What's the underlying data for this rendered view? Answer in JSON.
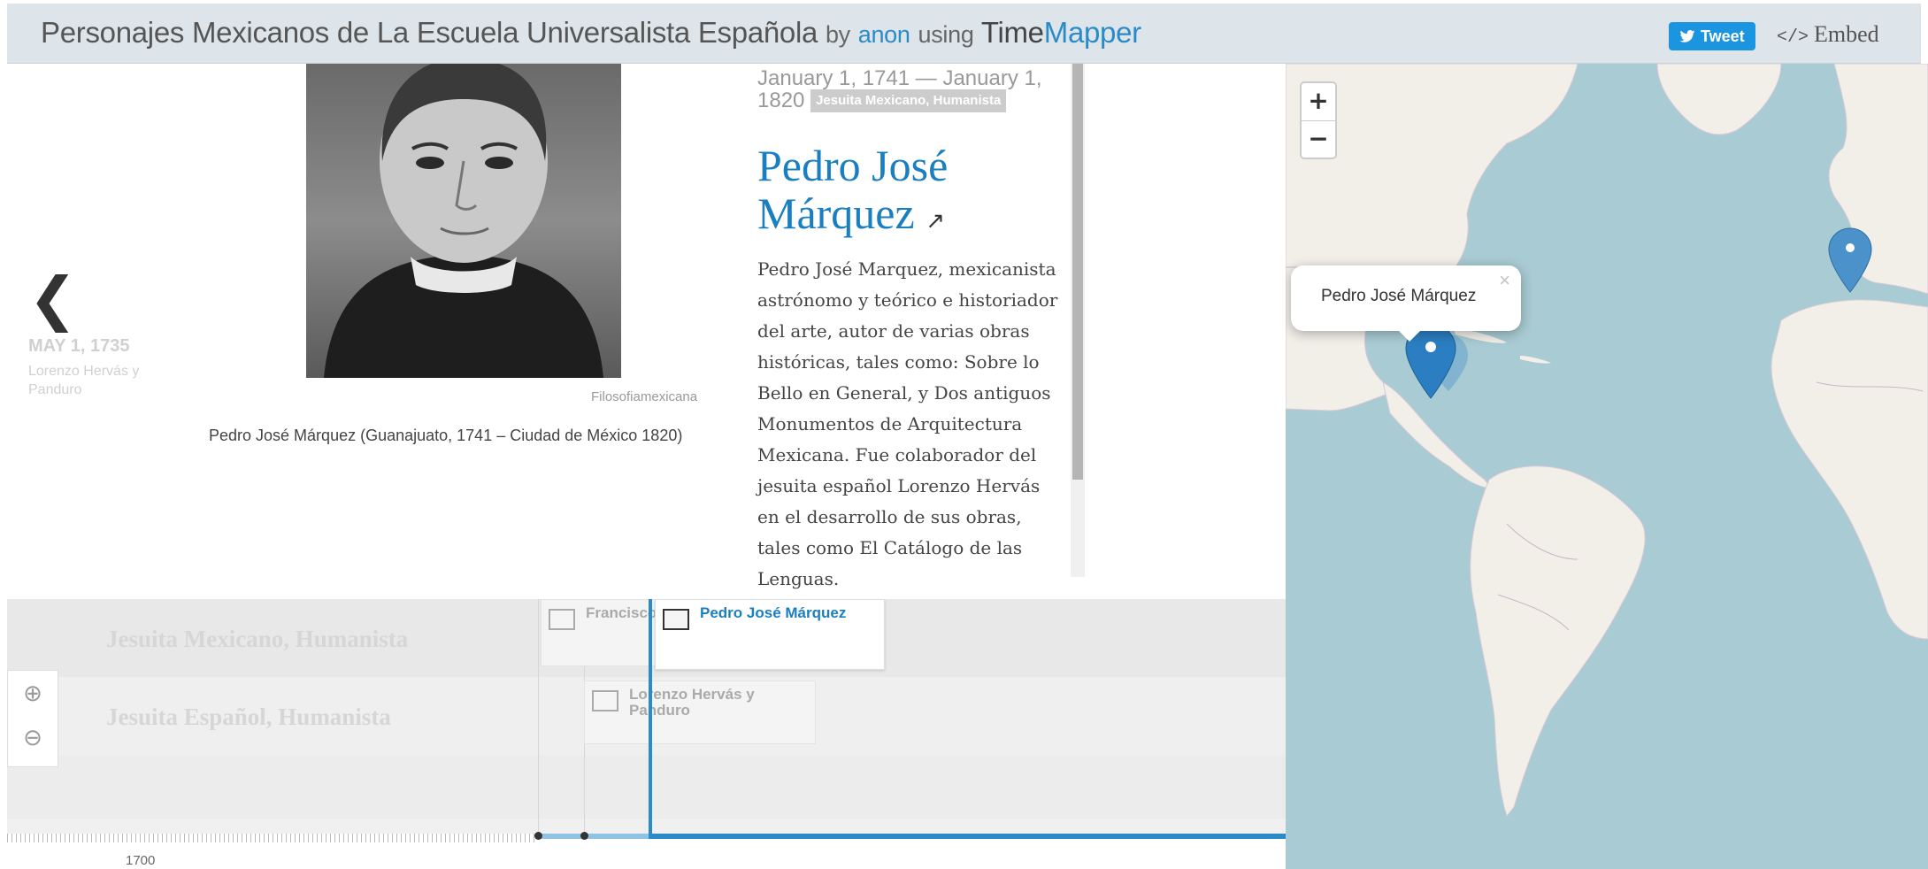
{
  "header": {
    "title": "Personajes Mexicanos de La Escuela Universalista Española",
    "by_label": "by",
    "author": "anon",
    "using_label": "using",
    "app_part1": "Time",
    "app_part2": "Mapper",
    "tweet_label": "Tweet",
    "embed_code": "</>",
    "embed_label": "Embed"
  },
  "prev_slide": {
    "date": "MAY 1, 1735",
    "name": "Lorenzo Hervás y Panduro"
  },
  "slide": {
    "credit": "Filosofiamexicana",
    "caption": "Pedro José Márquez (Guanajuato, 1741 – Ciudad de México 1820)",
    "dates": "January 1, 1741 — January 1, 1820",
    "tag": "Jesuita Mexicano, Humanista",
    "headline": "Pedro José Márquez",
    "body": "Pedro José Marquez, mexicanista astrónomo y teórico e historiador del arte, autor de varias obras históricas, tales como: Sobre lo Bello en General, y Dos antiguos Monumentos de Arquitectura Mexicana. Fue colaborador del jesuita español Lorenzo Hervás en el desarrollo de sus obras, tales como El Catálogo de las Lenguas."
  },
  "timeline": {
    "groups": [
      "Jesuita Mexicano, Humanista",
      "Jesuita Español, Humanista"
    ],
    "markers": [
      {
        "label": "Francisco Clavijero",
        "state": "dim"
      },
      {
        "label": "Pedro José Márquez",
        "state": "active"
      },
      {
        "label": "Lorenzo Hervás y Panduro",
        "state": "dim"
      }
    ],
    "axis_label": "1700",
    "zoom_in_icon": "zoom-in-icon",
    "zoom_out_icon": "zoom-out-icon"
  },
  "map": {
    "zoom_in": "+",
    "zoom_out": "−",
    "popup_text": "Pedro José Márquez",
    "popup_close": "×"
  },
  "colors": {
    "accent": "#2a8bc9",
    "header_bg": "#dde5ea",
    "map_water": "#a9cbd3",
    "map_land": "#f2efe9"
  }
}
